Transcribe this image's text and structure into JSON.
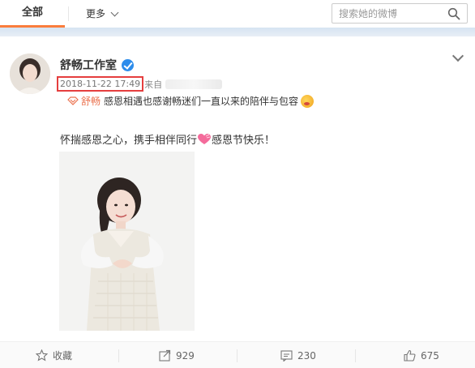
{
  "nav": {
    "tab_all": "全部",
    "tab_more": "更多",
    "search_placeholder": "搜索她的微博"
  },
  "post": {
    "author": "舒畅工作室",
    "timestamp": "2018-11-22 17:49",
    "source_prefix": "来自",
    "repost": {
      "name": "舒畅",
      "text": "感恩相遇也感谢畅迷们一直以来的陪伴与包容"
    },
    "body_before_emoji": "怀揣感恩之心，携手相伴同行",
    "body_after_emoji": "感恩节快乐！"
  },
  "actions": {
    "favorite_label": "收藏",
    "repost_count": "929",
    "comment_count": "230",
    "like_count": "675"
  },
  "colors": {
    "accent": "#fa7d3c",
    "highlight_box": "#e53e3e",
    "verified": "#2d8ceb",
    "link": "#eb7350"
  }
}
